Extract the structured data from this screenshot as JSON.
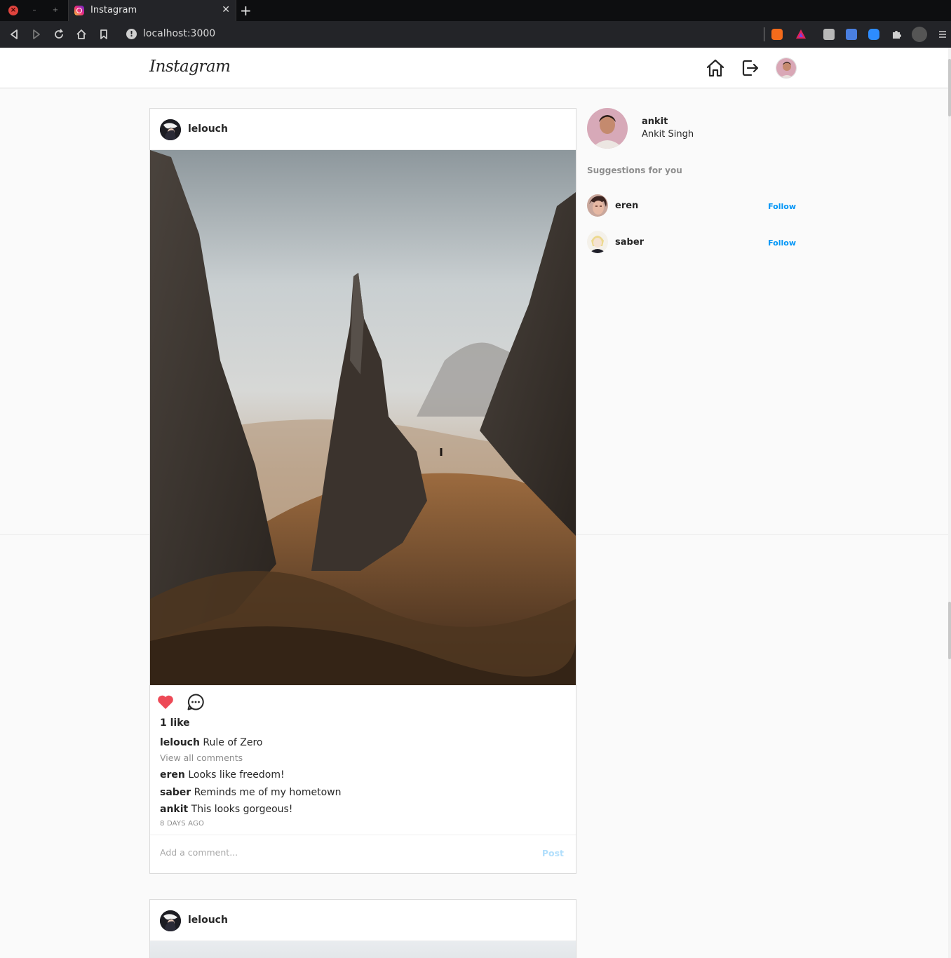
{
  "browser": {
    "tab_title": "Instagram",
    "url": "localhost:3000"
  },
  "header": {
    "logo": "Instagram"
  },
  "posts": [
    {
      "username": "lelouch",
      "likes_label": "1 like",
      "caption_user": "lelouch",
      "caption": "Rule of Zero",
      "view_all": "View all comments",
      "comments": [
        {
          "user": "eren",
          "text": "Looks like freedom!"
        },
        {
          "user": "saber",
          "text": "Reminds me of my hometown"
        },
        {
          "user": "ankit",
          "text": "This looks gorgeous!"
        }
      ],
      "time_ago": "8 DAYS AGO",
      "comment_placeholder": "Add a comment...",
      "post_label": "Post",
      "liked": true
    },
    {
      "username": "lelouch"
    }
  ],
  "sidebar": {
    "username": "ankit",
    "full_name": "Ankit Singh",
    "suggestions_title": "Suggestions for you",
    "suggestions": [
      {
        "username": "eren",
        "action": "Follow"
      },
      {
        "username": "saber",
        "action": "Follow"
      }
    ]
  },
  "colors": {
    "like": "#ed4956",
    "follow": "#0095f6",
    "post_disabled": "#b2dffc"
  }
}
